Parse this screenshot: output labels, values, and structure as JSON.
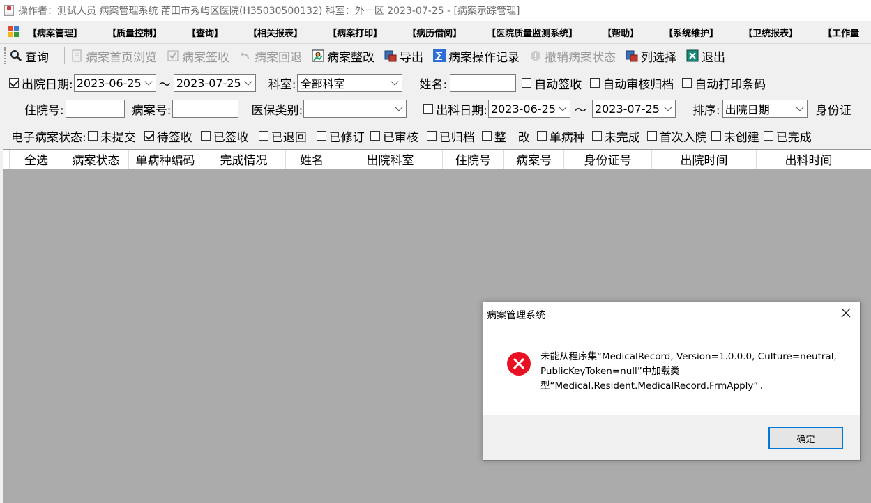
{
  "window": {
    "title": "操作者：测试人员 病案管理系统  莆田市秀屿区医院(H35030500132)  科室：外一区 2023-07-25  - [病案示踪管理]"
  },
  "menu": {
    "items": [
      "【病案管理】",
      "【质量控制】",
      "【查询】",
      "【相关报表】",
      "【病案打印】",
      "【病历借阅】",
      "【医院质量监测系统】",
      "【帮助】",
      "【系统维护】",
      "【卫统报表】",
      "【工作量"
    ]
  },
  "toolbar": {
    "query": "查询",
    "first_page_browse": "病案首页浏览",
    "sign_receive": "病案签收",
    "return": "病案回退",
    "rectify": "病案整改",
    "export": "导出",
    "operation_log": "病案操作记录",
    "revoke_status": "撤销病案状态",
    "column_select": "列选择",
    "exit": "退出"
  },
  "filters": {
    "discharge_date_label": "出院日期:",
    "discharge_from": "2023-06-25",
    "tilde": "～",
    "discharge_to": "2023-07-25",
    "dept_label": "科室:",
    "dept_value": "全部科室",
    "name_label": "姓名:",
    "auto_sign": "自动签收",
    "auto_review_archive": "自动审核归档",
    "auto_print_barcode": "自动打印条码",
    "inpatient_no_label": "住院号:",
    "case_no_label": "病案号:",
    "insurance_type_label": "医保类别:",
    "dept_discharge_date_label": "出科日期:",
    "dept_discharge_from": "2023-06-25",
    "dept_discharge_to": "2023-07-25",
    "sort_label": "排序:",
    "sort_value": "出院日期",
    "id_label_partial": "身份证",
    "emr_status_label": "电子病案状态:",
    "statuses": [
      "未提交",
      "待签收",
      "已签收",
      "已退回",
      "已修订",
      "已审核",
      "已归档",
      "整　改",
      "单病种",
      "未完成",
      "首次入院",
      "未创建",
      "已完成"
    ]
  },
  "grid": {
    "columns": [
      "全选",
      "病案状态",
      "单病种编码",
      "完成情况",
      "姓名",
      "出院科室",
      "住院号",
      "病案号",
      "身份证号",
      "出院时间",
      "出科时间"
    ]
  },
  "dialog": {
    "title": "病案管理系统",
    "message": "未能从程序集“MedicalRecord, Version=1.0.0.0, Culture=neutral, PublicKeyToken=null”中加载类型“Medical.Resident.MedicalRecord.FrmApply”。",
    "ok": "确定"
  },
  "colors": {
    "grid_background": "#ababab",
    "error_red": "#e81123",
    "focus_blue": "#0078d7"
  }
}
